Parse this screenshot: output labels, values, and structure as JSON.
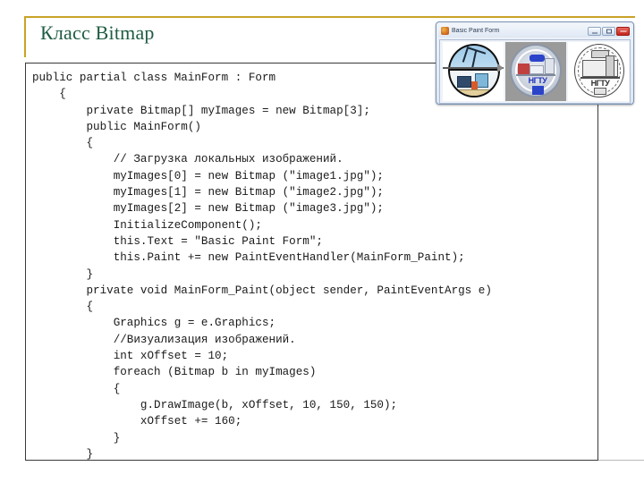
{
  "slide": {
    "title": "Класс Bitmap",
    "accent_color": "#c9a227",
    "title_color": "#1f5c42"
  },
  "code": {
    "language": "csharp",
    "lines": [
      "public partial class MainForm : Form",
      "    {",
      "        private Bitmap[] myImages = new Bitmap[3];",
      "        public MainForm()",
      "        {",
      "            // Загрузка локальных изображений.",
      "            myImages[0] = new Bitmap (\"image1.jpg\");",
      "            myImages[1] = new Bitmap (\"image2.jpg\");",
      "            myImages[2] = new Bitmap (\"image3.jpg\");",
      "            InitializeComponent();",
      "            this.Text = \"Basic Paint Form\";",
      "            this.Paint += new PaintEventHandler(MainForm_Paint);",
      "        }",
      "        private void MainForm_Paint(object sender, PaintEventArgs e)",
      "        {",
      "            Graphics g = e.Graphics;",
      "            //Визуализация изображений.",
      "            int xOffset = 10;",
      "            foreach (Bitmap b in myImages)",
      "            {",
      "                g.DrawImage(b, xOffset, 10, 150, 150);",
      "                xOffset += 160;",
      "            }",
      "        }",
      "}"
    ]
  },
  "winform": {
    "title": "Basic Paint Form",
    "app_icon": "paint-icon",
    "buttons": {
      "minimize": "minimize-icon",
      "maximize": "maximize-icon",
      "close": "close-icon"
    },
    "images": [
      {
        "alt": "image1.jpg",
        "caption": ""
      },
      {
        "alt": "image2.jpg",
        "caption": "НГТУ"
      },
      {
        "alt": "image3.jpg",
        "caption": "НГТУ"
      }
    ]
  }
}
